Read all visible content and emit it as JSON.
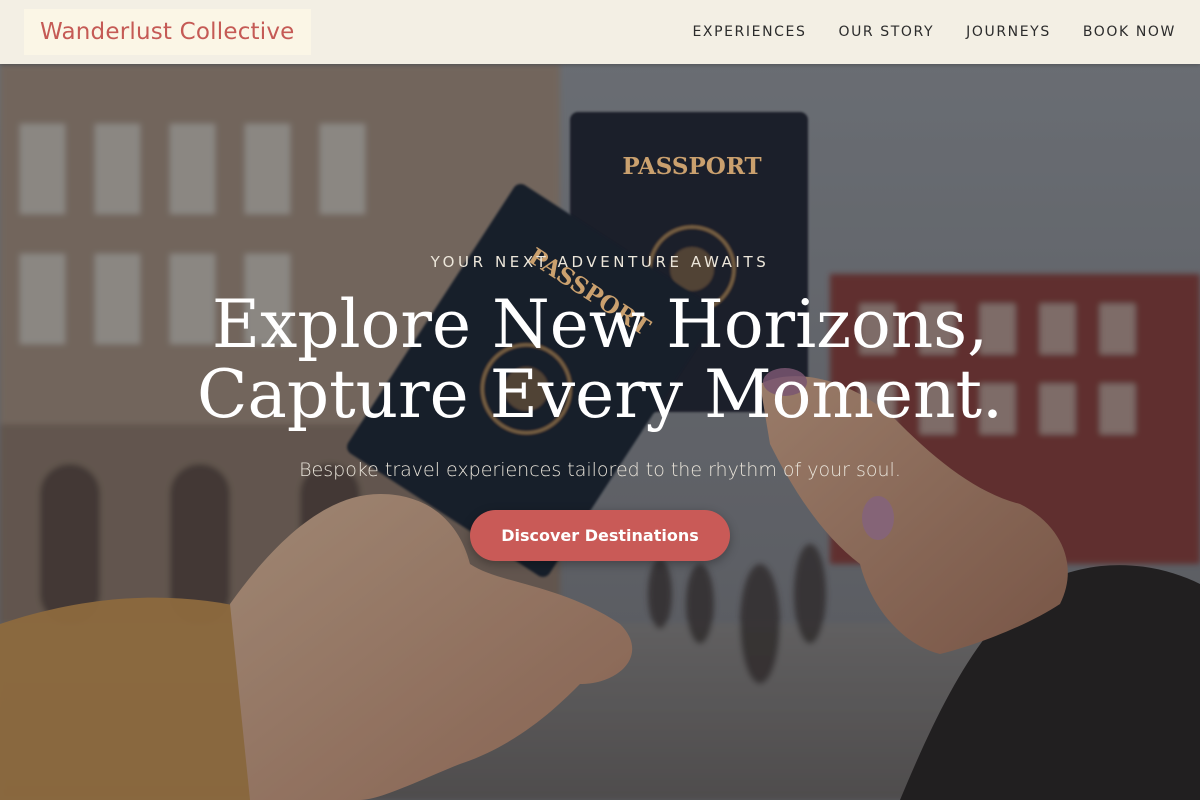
{
  "header": {
    "logo": "Wanderlust Collective",
    "nav": [
      {
        "label": "EXPERIENCES"
      },
      {
        "label": "OUR STORY"
      },
      {
        "label": "JOURNEYS"
      },
      {
        "label": "BOOK NOW"
      }
    ]
  },
  "hero": {
    "kicker": "YOUR NEXT ADVENTURE AWAITS",
    "headline_line1": "Explore New Horizons,",
    "headline_line2": "Capture Every Moment.",
    "subtitle": "Bespoke travel experiences tailored to the rhythm of your soul.",
    "cta_label": "Discover Destinations",
    "image": {
      "passport_word_1": "PASSPORT",
      "passport_word_2": "PASSPORT"
    }
  },
  "colors": {
    "accent": "#c95a57",
    "header_bg": "#f3efe4",
    "logo_text": "#c55a55",
    "passport_navy": "#1b2233",
    "passport_gold": "#c9a06a"
  }
}
